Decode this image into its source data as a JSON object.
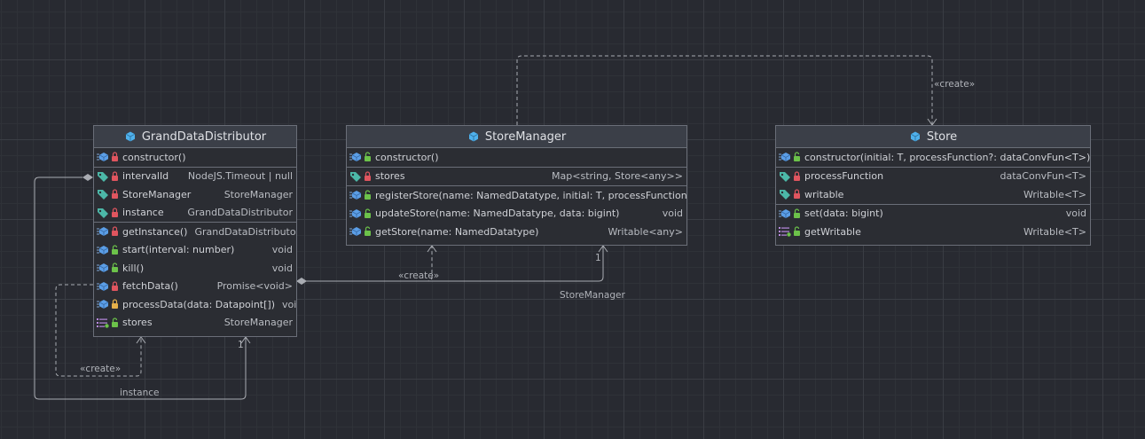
{
  "classes": {
    "grand": {
      "name": "GrandDataDistributor",
      "sections": [
        [
          {
            "icon": "method",
            "access": "private",
            "name": "constructor()",
            "type": ""
          }
        ],
        [
          {
            "icon": "field",
            "access": "private",
            "name": "intervalId",
            "type": "NodeJS.Timeout | null"
          },
          {
            "icon": "field",
            "access": "private",
            "name": "StoreManager",
            "type": "StoreManager"
          },
          {
            "icon": "field",
            "access": "private",
            "name": "instance",
            "type": "GrandDataDistributor"
          }
        ],
        [
          {
            "icon": "method",
            "access": "private",
            "name": "getInstance()",
            "type": "GrandDataDistributor"
          },
          {
            "icon": "method",
            "access": "public",
            "name": "start(interval: number)",
            "type": "void"
          },
          {
            "icon": "method",
            "access": "public",
            "name": "kill()",
            "type": "void"
          },
          {
            "icon": "method",
            "access": "private",
            "name": "fetchData()",
            "type": "Promise<void>"
          },
          {
            "icon": "method",
            "access": "protected",
            "name": "processData(data: Datapoint[])",
            "type": "void"
          },
          {
            "icon": "property",
            "access": "public",
            "name": "stores",
            "type": "StoreManager"
          }
        ]
      ]
    },
    "storeManager": {
      "name": "StoreManager",
      "sections": [
        [
          {
            "icon": "method",
            "access": "public",
            "name": "constructor()",
            "type": ""
          }
        ],
        [
          {
            "icon": "field",
            "access": "private",
            "name": "stores",
            "type": "Map<string, Store<any>>"
          }
        ],
        [
          {
            "icon": "method",
            "access": "public",
            "name": "registerStore(name: NamedDatatype, initial: T, processFunction?: da",
            "type": ""
          },
          {
            "icon": "method",
            "access": "public",
            "name": "updateStore(name: NamedDatatype, data: bigint)",
            "type": "void"
          },
          {
            "icon": "method",
            "access": "public",
            "name": "getStore(name: NamedDatatype)",
            "type": "Writable<any>"
          }
        ]
      ]
    },
    "store": {
      "name": "Store",
      "sections": [
        [
          {
            "icon": "method",
            "access": "public",
            "name": "constructor(initial: T, processFunction?: dataConvFun<T>)",
            "type": ""
          }
        ],
        [
          {
            "icon": "field",
            "access": "private",
            "name": "processFunction",
            "type": "dataConvFun<T>"
          },
          {
            "icon": "field",
            "access": "private",
            "name": "writable",
            "type": "Writable<T>"
          }
        ],
        [
          {
            "icon": "method",
            "access": "public",
            "name": "set(data: bigint)",
            "type": "void"
          },
          {
            "icon": "property",
            "access": "public",
            "name": "getWritable",
            "type": "Writable<T>"
          }
        ]
      ]
    }
  },
  "edge_labels": {
    "create_store": "«create»",
    "create_storemanager": "«create»",
    "create_self": "«create»",
    "storemanager_role": "StoreManager",
    "storemanager_mult": "1",
    "instance_role": "instance",
    "instance_mult": "1"
  },
  "colors": {
    "private_lock": "#e0555f",
    "public_lock": "#6cc24a",
    "protected_lock": "#e5b04a",
    "class_icon": "#4fb1ec",
    "edge": "#a9acb2"
  }
}
